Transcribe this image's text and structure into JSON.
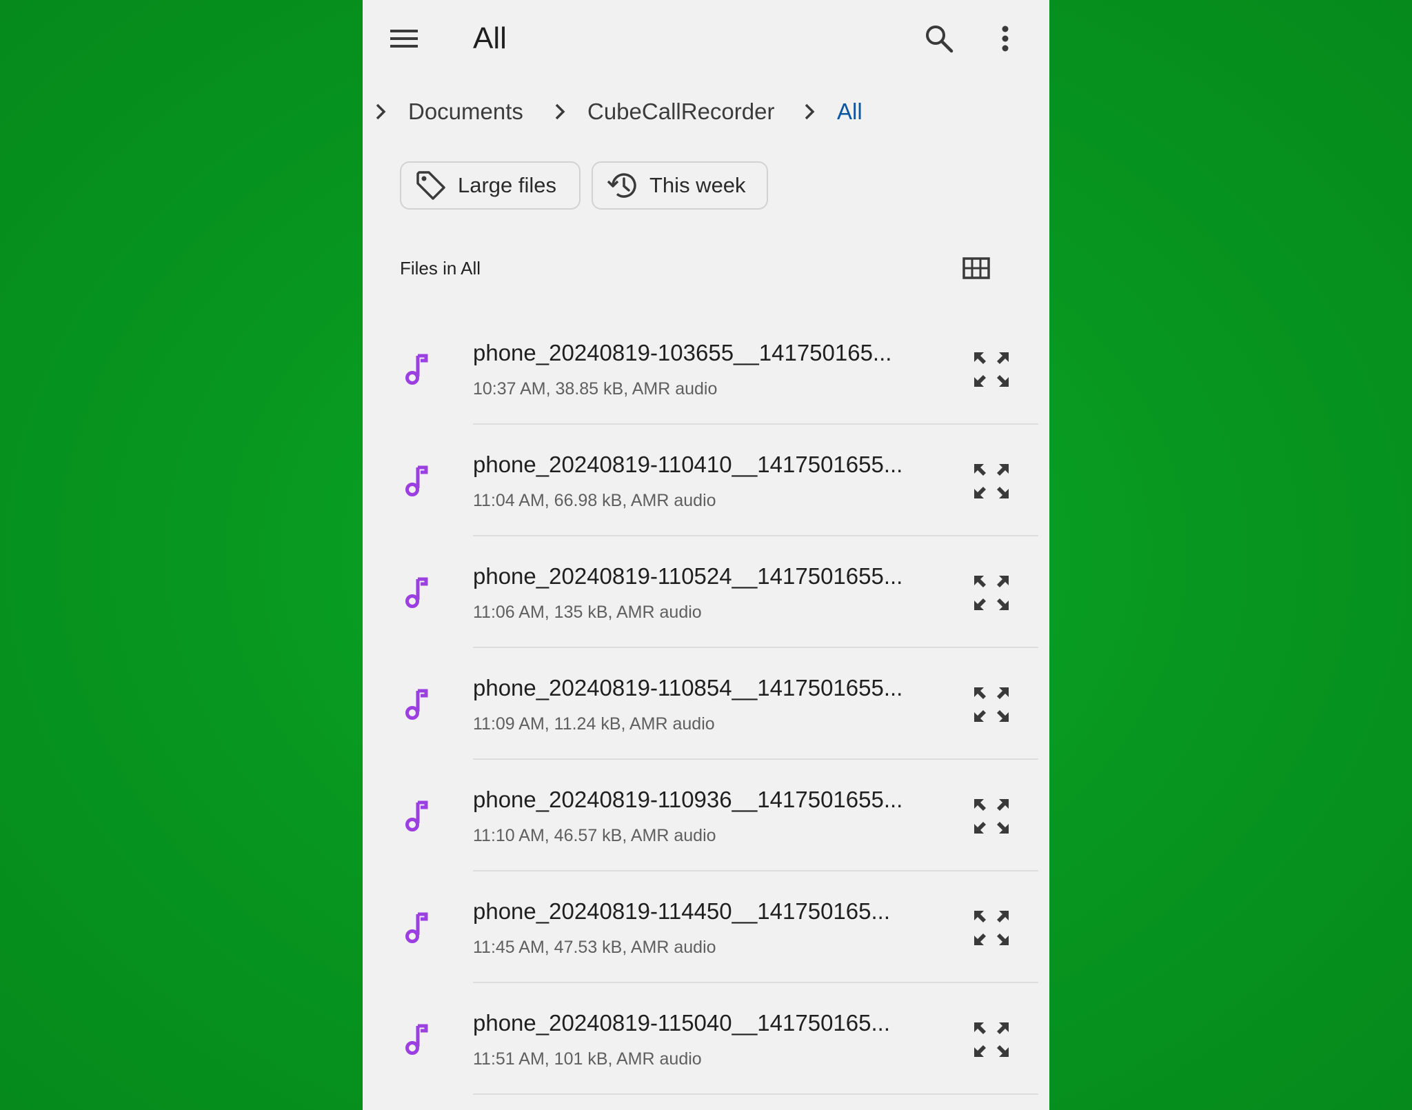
{
  "appbar": {
    "title": "All",
    "menu_icon": "hamburger-menu-icon",
    "search_icon": "search-icon",
    "more_icon": "more-vert-icon"
  },
  "breadcrumb": {
    "items": [
      "Documents",
      "CubeCallRecorder",
      "All"
    ],
    "active_color": "#0b57a0"
  },
  "chips": [
    {
      "label": "Large files",
      "icon": "tag-icon"
    },
    {
      "label": "This week",
      "icon": "history-icon"
    }
  ],
  "section": {
    "title": "Files in All",
    "view_toggle_icon": "grid-view-icon"
  },
  "files": [
    {
      "name": "phone_20240819-103655__141750165...",
      "meta": "10:37 AM, 38.85 kB, AMR audio"
    },
    {
      "name": "phone_20240819-110410__1417501655...",
      "meta": "11:04 AM, 66.98 kB, AMR audio"
    },
    {
      "name": "phone_20240819-110524__1417501655...",
      "meta": "11:06 AM, 135 kB, AMR audio"
    },
    {
      "name": "phone_20240819-110854__1417501655...",
      "meta": "11:09 AM, 11.24 kB, AMR audio"
    },
    {
      "name": "phone_20240819-110936__1417501655...",
      "meta": "11:10 AM, 46.57 kB, AMR audio"
    },
    {
      "name": "phone_20240819-114450__141750165...",
      "meta": "11:45 AM, 47.53 kB, AMR audio"
    },
    {
      "name": "phone_20240819-115040__141750165...",
      "meta": "11:51 AM, 101 kB, AMR audio"
    }
  ],
  "colors": {
    "background": "#079a22",
    "surface": "#f1f1f1",
    "audio_icon": "#9b3fe0"
  }
}
